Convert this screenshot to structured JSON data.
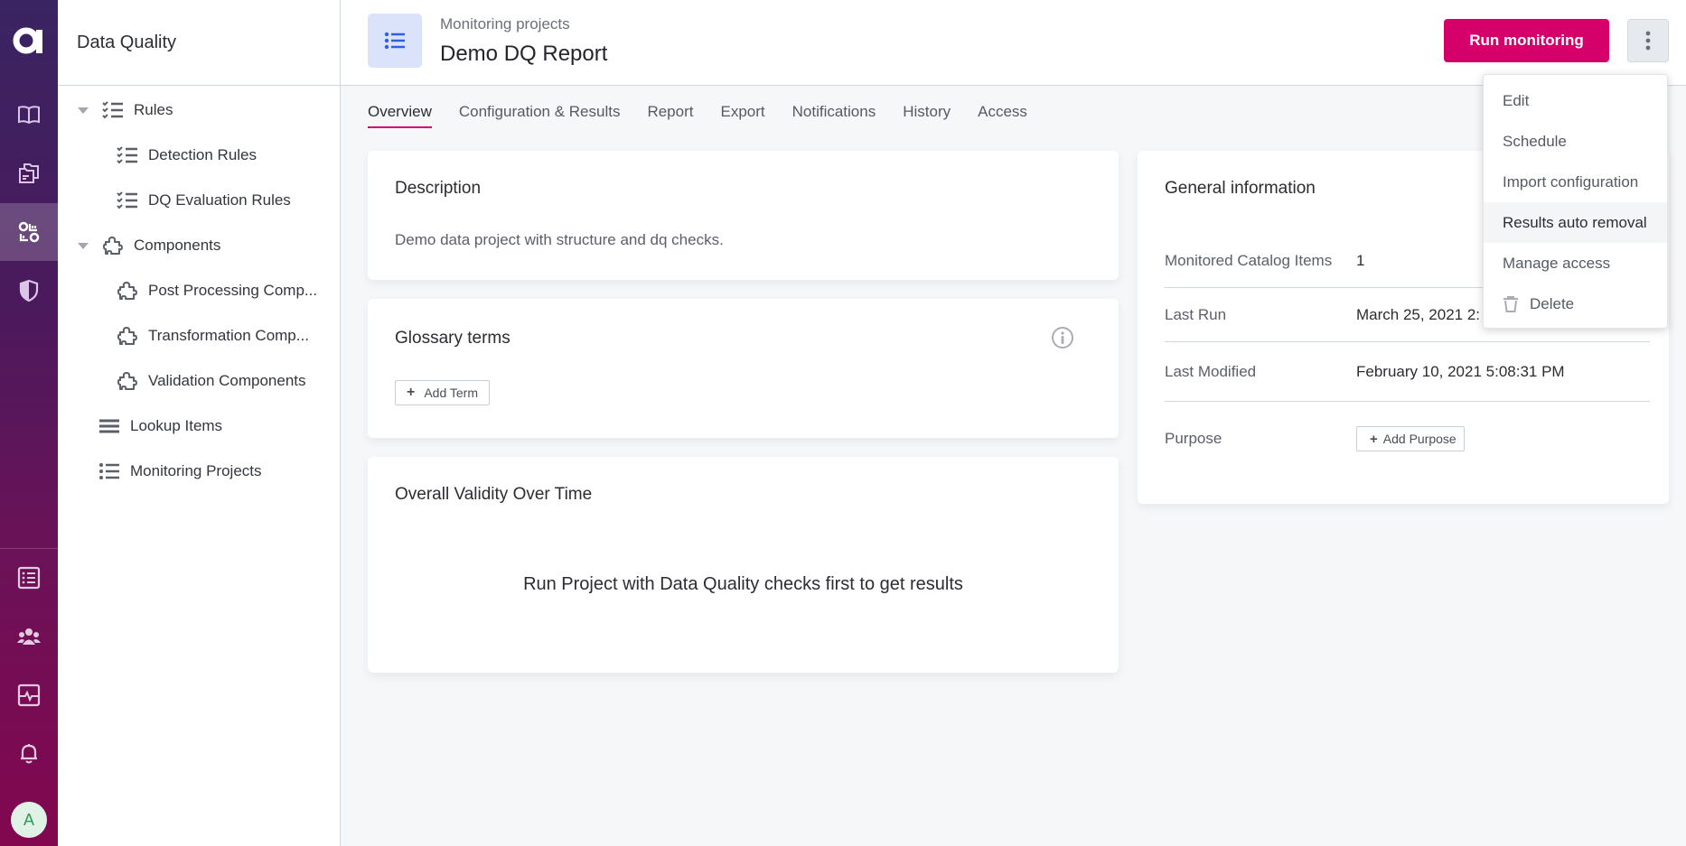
{
  "rail": {
    "logo": "a",
    "items": [
      {
        "icon": "book-icon"
      },
      {
        "icon": "folders-icon"
      },
      {
        "icon": "data-quality-icon",
        "active": true
      },
      {
        "icon": "shield-icon"
      },
      {
        "icon": "list-box-icon"
      },
      {
        "icon": "users-icon"
      },
      {
        "icon": "activity-monitor-icon"
      },
      {
        "icon": "bell-icon"
      }
    ],
    "avatar_initial": "A"
  },
  "sidebar": {
    "title": "Data Quality",
    "tree": [
      {
        "label": "Rules",
        "icon": "checklist-icon",
        "expandable": true,
        "level": 0
      },
      {
        "label": "Detection Rules",
        "icon": "checklist-icon",
        "level": 1
      },
      {
        "label": "DQ Evaluation Rules",
        "icon": "checklist-icon",
        "level": 1
      },
      {
        "label": "Components",
        "icon": "puzzle-icon",
        "expandable": true,
        "level": 0
      },
      {
        "label": "Post Processing Comp...",
        "icon": "puzzle-icon",
        "level": 1
      },
      {
        "label": "Transformation Comp...",
        "icon": "puzzle-icon",
        "level": 1
      },
      {
        "label": "Validation Components",
        "icon": "puzzle-icon",
        "level": 1
      },
      {
        "label": "Lookup Items",
        "icon": "lines-icon",
        "level": 0
      },
      {
        "label": "Monitoring Projects",
        "icon": "bullet-list-icon",
        "level": 0
      }
    ]
  },
  "header": {
    "breadcrumb": "Monitoring projects",
    "title": "Demo DQ Report",
    "run_button": "Run monitoring",
    "more_icon": "kebab-icon"
  },
  "tabs": [
    {
      "label": "Overview",
      "active": true
    },
    {
      "label": "Configuration & Results"
    },
    {
      "label": "Report"
    },
    {
      "label": "Export"
    },
    {
      "label": "Notifications"
    },
    {
      "label": "History"
    },
    {
      "label": "Access"
    }
  ],
  "description": {
    "title": "Description",
    "text": "Demo data project with structure and dq checks."
  },
  "glossary": {
    "title": "Glossary terms",
    "add_label": "Add Term"
  },
  "validity": {
    "title": "Overall Validity Over Time",
    "empty_message": "Run Project with Data Quality checks first to get results"
  },
  "general_info": {
    "title": "General information",
    "rows": [
      {
        "label": "Monitored Catalog Items",
        "value": "1"
      },
      {
        "label": "Last Run",
        "value": "March 25, 2021 2:"
      },
      {
        "label": "Last Modified",
        "value": "February 10, 2021 5:08:31 PM"
      },
      {
        "label": "Purpose",
        "button": "Add Purpose"
      }
    ]
  },
  "menu": {
    "items": [
      {
        "label": "Edit"
      },
      {
        "label": "Schedule"
      },
      {
        "label": "Import configuration"
      },
      {
        "label": "Results auto removal",
        "hovered": true
      },
      {
        "label": "Manage access"
      },
      {
        "label": "Delete",
        "icon": "trash-icon"
      }
    ]
  },
  "colors": {
    "accent": "#d6006b",
    "rail_top": "#3a2462",
    "rail_bottom": "#82074f",
    "project_icon_bg": "#dbe3fb",
    "project_icon": "#2f5ee0"
  }
}
